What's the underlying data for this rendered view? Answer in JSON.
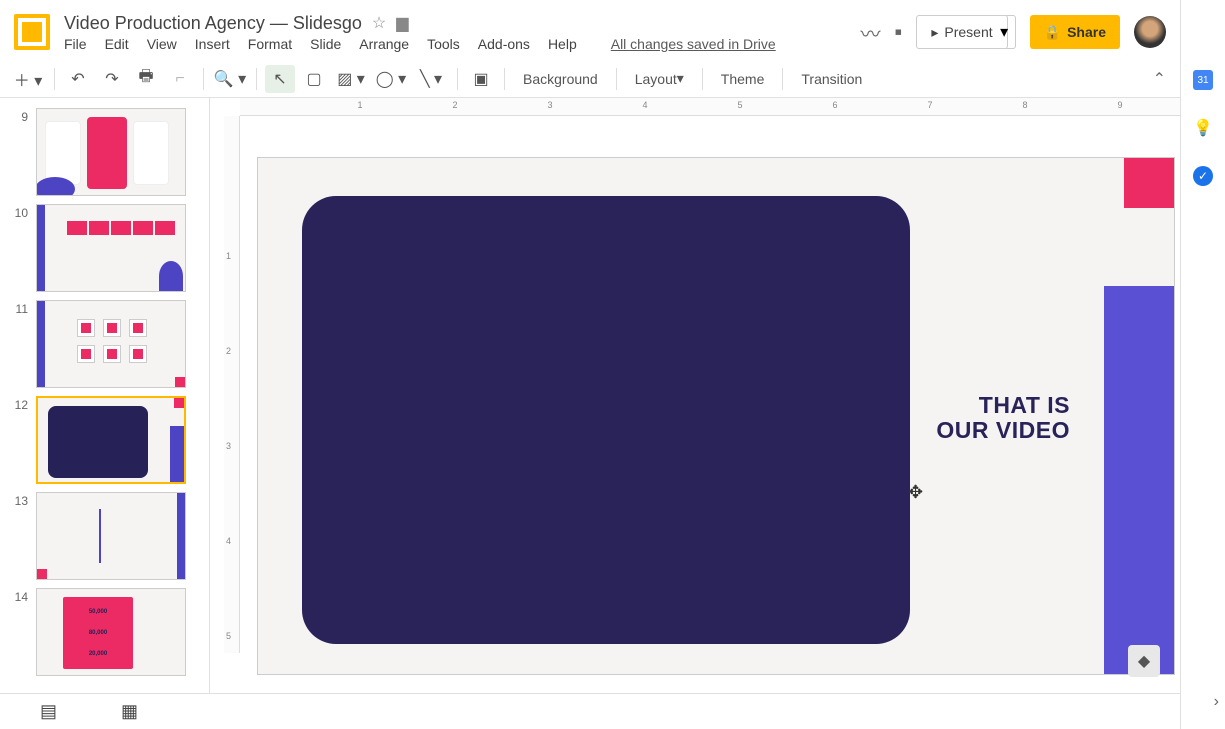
{
  "doc": {
    "title": "Video Production Agency — Slidesgo",
    "saved_status": "All changes saved in Drive"
  },
  "menu": {
    "file": "File",
    "edit": "Edit",
    "view": "View",
    "insert": "Insert",
    "format": "Format",
    "slide": "Slide",
    "arrange": "Arrange",
    "tools": "Tools",
    "addons": "Add-ons",
    "help": "Help"
  },
  "header_buttons": {
    "present": "Present",
    "share": "Share"
  },
  "toolbar": {
    "background": "Background",
    "layout": "Layout",
    "theme": "Theme",
    "transition": "Transition"
  },
  "thumbs": {
    "n9": "9",
    "n10": "10",
    "n11": "11",
    "n12": "12",
    "n13": "13",
    "n14": "14",
    "t14_a": "50,000",
    "t14_b": "80,000",
    "t14_c": "20,000"
  },
  "canvas": {
    "text_line1": "THAT IS",
    "text_line2": "OUR VIDEO"
  },
  "ruler": {
    "h1": "1",
    "h2": "2",
    "h3": "3",
    "h4": "4",
    "h5": "5",
    "h6": "6",
    "h7": "7",
    "h8": "8",
    "h9": "9",
    "v1": "1",
    "v2": "2",
    "v3": "3",
    "v4": "4",
    "v5": "5"
  }
}
